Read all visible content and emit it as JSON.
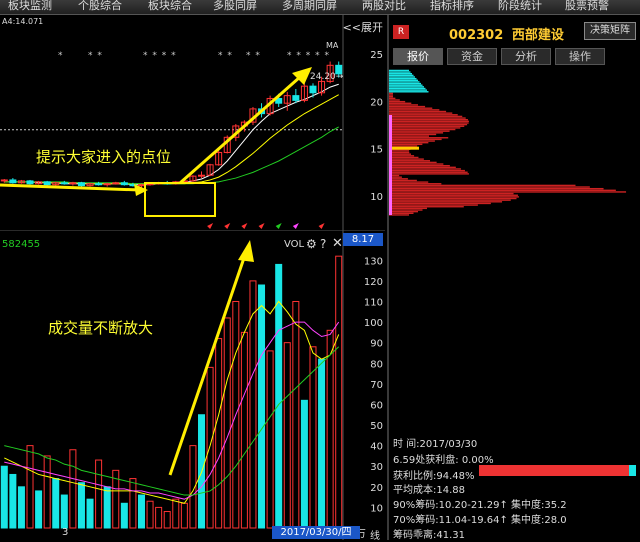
{
  "menubar": {
    "items": [
      "板块监测",
      "个股综合",
      "板块综合",
      "多股同屏",
      "多周期同屏",
      "两股对比",
      "指标排序",
      "阶段统计",
      "股票预警"
    ]
  },
  "kline": {
    "ma_label": "A4:14.071",
    "expand": "<<展开",
    "ma_tag": "MA",
    "peak_label": "24.20→",
    "stars": [
      "*",
      "* *",
      "* * * *",
      "* *",
      "* *",
      "* * * * *"
    ],
    "price_badge": "8.17"
  },
  "volume": {
    "left_label": "582455",
    "vol_title": "VOL",
    "unit": "X万",
    "date_badge": "2017/03/30/四",
    "bottom_left": "3",
    "bottom_right": "线"
  },
  "annotations": {
    "callout_1": "提示大家进入的点位",
    "callout_2": "成交量不断放大"
  },
  "right_panel": {
    "badge": "R",
    "code": "002302",
    "name": "西部建设",
    "decision_button": "决策矩阵",
    "tabs": [
      "报价",
      "资金",
      "分析",
      "操作"
    ],
    "active_tab": "报价"
  },
  "chip_info": {
    "lines": [
      "时        间:2017/03/30",
      "6.59处获利盘: 0.00%",
      "获利比例:94.48%",
      "平均成本:14.88",
      "90%筹码:10.20-21.29↑ 集中度:35.2",
      "70%筹码:11.04-19.64↑ 集中度:28.0",
      "筹码乖离:41.31"
    ],
    "profit_ratio": 0.9448
  },
  "chart_data": [
    {
      "type": "candlestick",
      "title": "",
      "yticks": [
        10,
        15,
        20,
        25
      ],
      "ylim": [
        8,
        27
      ],
      "colors": {
        "up": "#ff3333",
        "down": "#19e6e6",
        "ma5": "#ffffff",
        "ma10": "#ffff00",
        "ma20": "#22cc22"
      },
      "dates_index": [
        1,
        2,
        3,
        4,
        5,
        6,
        7,
        8,
        9,
        10,
        11,
        12,
        13,
        14,
        15,
        16,
        17,
        18,
        19,
        20,
        21,
        22,
        23,
        24,
        25,
        26,
        27,
        28,
        29,
        30,
        31,
        32,
        33,
        34,
        35,
        36,
        37,
        38,
        39,
        40
      ],
      "ohlc": [
        [
          11.6,
          11.8,
          11.4,
          11.7
        ],
        [
          11.7,
          11.9,
          11.3,
          11.4
        ],
        [
          11.4,
          11.7,
          11.3,
          11.6
        ],
        [
          11.6,
          11.7,
          11.2,
          11.3
        ],
        [
          11.3,
          11.6,
          11.2,
          11.5
        ],
        [
          11.5,
          11.6,
          11.1,
          11.2
        ],
        [
          11.2,
          11.5,
          11.1,
          11.4
        ],
        [
          11.4,
          11.6,
          11.2,
          11.3
        ],
        [
          11.3,
          11.5,
          11.1,
          11.4
        ],
        [
          11.4,
          11.5,
          11.0,
          11.1
        ],
        [
          11.1,
          11.4,
          11.0,
          11.3
        ],
        [
          11.3,
          11.5,
          11.1,
          11.2
        ],
        [
          11.2,
          11.4,
          11.0,
          11.3
        ],
        [
          11.3,
          11.5,
          11.2,
          11.4
        ],
        [
          11.4,
          11.6,
          11.1,
          11.2
        ],
        [
          11.2,
          11.4,
          11.0,
          11.1
        ],
        [
          11.1,
          11.3,
          10.9,
          11.2
        ],
        [
          11.2,
          11.4,
          11.1,
          11.3
        ],
        [
          11.3,
          11.5,
          11.2,
          11.4
        ],
        [
          11.4,
          11.6,
          11.2,
          11.3
        ],
        [
          11.3,
          11.6,
          11.2,
          11.5
        ],
        [
          11.5,
          11.7,
          11.3,
          11.6
        ],
        [
          11.6,
          12.2,
          11.5,
          12.1
        ],
        [
          12.1,
          12.6,
          11.9,
          12.2
        ],
        [
          12.2,
          13.4,
          12.1,
          13.3
        ],
        [
          13.3,
          14.8,
          13.2,
          14.6
        ],
        [
          14.6,
          16.4,
          14.5,
          16.2
        ],
        [
          16.2,
          17.6,
          15.8,
          17.4
        ],
        [
          17.4,
          18.0,
          16.8,
          17.8
        ],
        [
          17.8,
          19.4,
          17.5,
          19.2
        ],
        [
          19.2,
          19.8,
          18.3,
          18.7
        ],
        [
          18.7,
          20.6,
          18.5,
          20.3
        ],
        [
          20.3,
          20.8,
          19.4,
          19.8
        ],
        [
          19.8,
          21.0,
          19.0,
          20.6
        ],
        [
          20.6,
          21.3,
          19.8,
          20.1
        ],
        [
          20.1,
          22.0,
          19.9,
          21.6
        ],
        [
          21.6,
          21.9,
          20.4,
          20.9
        ],
        [
          20.9,
          22.6,
          20.6,
          22.1
        ],
        [
          22.1,
          24.2,
          21.9,
          23.8
        ],
        [
          23.8,
          24.2,
          22.5,
          22.9
        ]
      ],
      "ma_lines": {
        "ma5": [
          11.5,
          11.5,
          11.5,
          11.5,
          11.4,
          11.4,
          11.4,
          11.3,
          11.3,
          11.3,
          11.3,
          11.3,
          11.3,
          11.3,
          11.3,
          11.2,
          11.2,
          11.2,
          11.3,
          11.3,
          11.3,
          11.4,
          11.6,
          11.8,
          12.2,
          12.8,
          13.7,
          14.8,
          15.9,
          17.0,
          17.9,
          18.7,
          19.1,
          19.5,
          19.9,
          20.2,
          20.6,
          21.0,
          21.5,
          21.8
        ],
        "ma10": [
          11.5,
          11.5,
          11.5,
          11.5,
          11.5,
          11.4,
          11.4,
          11.4,
          11.4,
          11.4,
          11.3,
          11.3,
          11.3,
          11.3,
          11.3,
          11.3,
          11.3,
          11.3,
          11.3,
          11.3,
          11.3,
          11.3,
          11.4,
          11.5,
          11.7,
          12.0,
          12.5,
          13.1,
          13.8,
          14.5,
          15.3,
          16.1,
          16.8,
          17.5,
          18.1,
          18.7,
          19.2,
          19.7,
          20.2,
          20.7
        ],
        "ma20": [
          11.5,
          11.5,
          11.5,
          11.5,
          11.5,
          11.5,
          11.5,
          11.5,
          11.4,
          11.4,
          11.4,
          11.4,
          11.4,
          11.4,
          11.4,
          11.3,
          11.3,
          11.3,
          11.3,
          11.3,
          11.3,
          11.3,
          11.3,
          11.4,
          11.4,
          11.5,
          11.7,
          11.9,
          12.2,
          12.5,
          12.9,
          13.3,
          13.7,
          14.2,
          14.7,
          15.2,
          15.7,
          16.2,
          16.8,
          17.3
        ]
      },
      "reference_line": 17.0,
      "peak_value": 24.2
    },
    {
      "type": "bar",
      "title": "VOL",
      "yticks": [
        10,
        20,
        30,
        40,
        50,
        60,
        70,
        80,
        90,
        100,
        110,
        120,
        130
      ],
      "ylim": [
        0,
        135
      ],
      "unit": "X万",
      "values": [
        30,
        26,
        20,
        40,
        18,
        35,
        24,
        16,
        38,
        22,
        14,
        33,
        20,
        28,
        12,
        24,
        16,
        13,
        10,
        8,
        14,
        12,
        40,
        55,
        78,
        92,
        102,
        110,
        95,
        120,
        118,
        86,
        128,
        90,
        110,
        62,
        88,
        82,
        96,
        132
      ],
      "up_flags": [
        0,
        0,
        0,
        1,
        0,
        1,
        0,
        0,
        1,
        0,
        0,
        1,
        0,
        1,
        0,
        1,
        0,
        1,
        1,
        1,
        1,
        1,
        1,
        0,
        1,
        1,
        1,
        1,
        1,
        1,
        0,
        1,
        0,
        1,
        1,
        0,
        1,
        0,
        1,
        1
      ],
      "ma_lines": {
        "ma5": [
          34,
          32,
          30,
          28,
          26,
          25,
          24,
          23,
          22,
          21,
          20,
          19,
          18,
          18,
          18,
          18,
          17,
          16,
          15,
          14,
          13,
          12,
          18,
          27,
          40,
          55,
          72,
          85,
          95,
          104,
          108,
          104,
          110,
          105,
          99,
          96,
          85,
          82,
          84,
          94
        ],
        "ma10": [
          32,
          31,
          30,
          29,
          28,
          27,
          26,
          25,
          24,
          23,
          22,
          21,
          20,
          19,
          19,
          18,
          18,
          17,
          17,
          16,
          15,
          14,
          16,
          20,
          26,
          34,
          44,
          55,
          65,
          75,
          84,
          90,
          96,
          98,
          100,
          100,
          96,
          93,
          94,
          100
        ],
        "ma20": [
          40,
          39,
          38,
          37,
          36,
          34,
          33,
          31,
          30,
          28,
          27,
          26,
          25,
          24,
          23,
          22,
          21,
          20,
          19,
          18,
          17,
          16,
          16,
          17,
          18,
          21,
          25,
          30,
          36,
          42,
          48,
          54,
          60,
          64,
          68,
          72,
          76,
          80,
          84,
          88
        ]
      }
    }
  ],
  "chip_distribution": {
    "yticks": [
      10,
      15,
      20,
      25
    ],
    "highlight_price": 14.88
  }
}
